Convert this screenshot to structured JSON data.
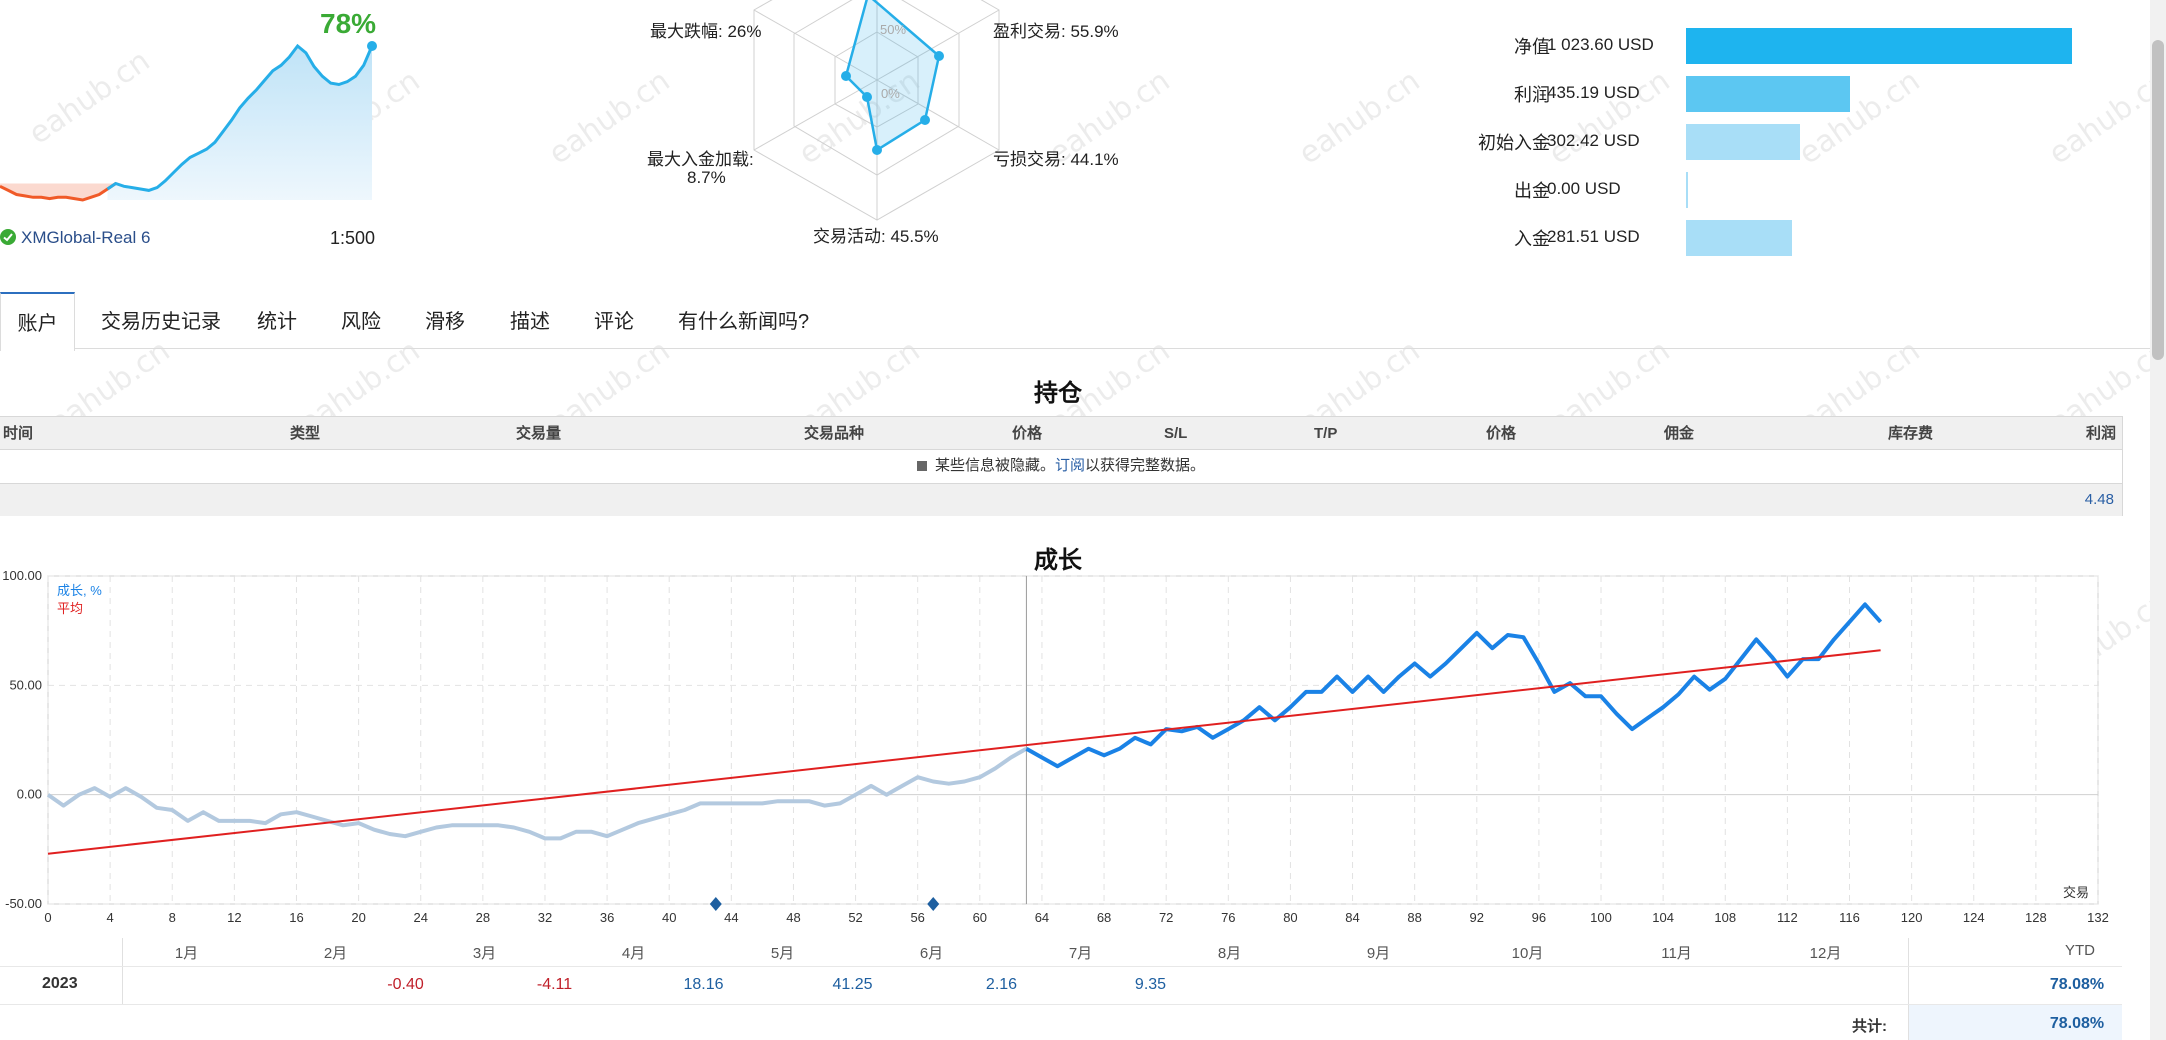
{
  "summary": {
    "growth_pct": "78%",
    "server": "XMGlobal-Real 6",
    "leverage": "1:500"
  },
  "radar": {
    "max_drawdown": "最大跌幅: 26%",
    "profit_trades": "盈利交易: 55.9%",
    "max_deposit_load_l1": "最大入金加载:",
    "max_deposit_load_l2": "8.7%",
    "loss_trades": "亏损交易: 44.1%",
    "activity": "交易活动: 45.5%",
    "ring_50": "50%",
    "ring_0": "0%"
  },
  "balance": {
    "rows": [
      {
        "label": "净值",
        "value": "1 023.60 USD",
        "amount": 1023.6,
        "color": "#1eb4ef"
      },
      {
        "label": "利润",
        "value": "435.19 USD",
        "amount": 435.19,
        "color": "#5cc7f2"
      },
      {
        "label": "初始入金",
        "value": "302.42 USD",
        "amount": 302.42,
        "color": "#a8def7"
      },
      {
        "label": "出金",
        "value": "0.00 USD",
        "amount": 0.0,
        "color": "#a8def7"
      },
      {
        "label": "入金",
        "value": "281.51 USD",
        "amount": 281.51,
        "color": "#a8def7"
      }
    ]
  },
  "tabs": [
    "账户",
    "交易历史记录",
    "统计",
    "风险",
    "滑移",
    "描述",
    "评论",
    "有什么新闻吗?"
  ],
  "positions": {
    "title": "持仓",
    "headers": [
      "时间",
      "类型",
      "交易量",
      "交易品种",
      "价格",
      "S/L",
      "T/P",
      "价格",
      "佣金",
      "库存费",
      "利润"
    ],
    "hidden_text": "某些信息被隐藏。",
    "subscribe_link": "订阅",
    "hidden_text_tail": "以获得完整数据。",
    "total": "4.48"
  },
  "growth": {
    "title": "成长",
    "legend_growth": "成长, %",
    "legend_avg": "平均",
    "x_axis_label": "交易",
    "months": [
      "1月",
      "2月",
      "3月",
      "4月",
      "5月",
      "6月",
      "7月",
      "8月",
      "9月",
      "10月",
      "11月",
      "12月"
    ],
    "year": "2023",
    "month_values": [
      "",
      "-0.40",
      "-4.11",
      "18.16",
      "41.25",
      "2.16",
      "9.35",
      "",
      "",
      "",
      "",
      ""
    ],
    "ytd_label": "YTD",
    "ytd_value": "78.08%",
    "total_label": "共计:",
    "total_value": "78.08%"
  },
  "chart_data": {
    "type": "line",
    "title": "成长",
    "xlabel": "交易",
    "ylabel": "",
    "xlim": [
      0,
      132
    ],
    "ylim": [
      -50,
      100
    ],
    "x_ticks": [
      0,
      4,
      8,
      12,
      16,
      20,
      24,
      28,
      32,
      36,
      40,
      44,
      48,
      52,
      56,
      60,
      64,
      68,
      72,
      76,
      80,
      84,
      88,
      92,
      96,
      100,
      104,
      108,
      112,
      116,
      120,
      124,
      128,
      132
    ],
    "y_ticks": [
      -50,
      0,
      50,
      100
    ],
    "y_tick_labels": [
      "-50.00",
      "0.00",
      "50.00",
      "100.00"
    ],
    "series": [
      {
        "name": "成长, %",
        "color": "#b3c9df",
        "x": [
          0,
          1,
          2,
          3,
          4,
          5,
          6,
          7,
          8,
          9,
          10,
          11,
          12,
          13,
          14,
          15,
          16,
          17,
          18,
          19,
          20,
          21,
          22,
          23,
          24,
          25,
          26,
          27,
          28,
          29,
          30,
          31,
          32,
          33,
          34,
          35,
          36,
          37,
          38,
          39,
          40,
          41,
          42,
          43,
          44,
          45,
          46,
          47,
          48,
          49,
          50,
          51,
          52,
          53,
          54,
          55,
          56,
          57,
          58,
          59,
          60,
          61,
          62,
          63
        ],
        "y": [
          0,
          -5,
          0,
          3,
          -1,
          3,
          -1,
          -6,
          -7,
          -12,
          -8,
          -12,
          -12,
          -12,
          -13,
          -9,
          -8,
          -10,
          -12,
          -14,
          -13,
          -16,
          -18,
          -19,
          -17,
          -15,
          -14,
          -14,
          -14,
          -14,
          -15,
          -17,
          -20,
          -20,
          -17,
          -17,
          -19,
          -16,
          -13,
          -11,
          -9,
          -7,
          -4,
          -4,
          -4,
          -4,
          -4,
          -3,
          -3,
          -3,
          -5,
          -4,
          0,
          4,
          0,
          4,
          8,
          6,
          5,
          6,
          8,
          12,
          17,
          21
        ]
      },
      {
        "name": "成长, %",
        "color": "#1a82e6",
        "x": [
          63,
          64,
          65,
          66,
          67,
          68,
          69,
          70,
          71,
          72,
          73,
          74,
          75,
          76,
          77,
          78,
          79,
          80,
          81,
          82,
          83,
          84,
          85,
          86,
          87,
          88,
          89,
          90,
          91,
          92,
          93,
          94,
          95,
          96,
          97,
          98,
          99,
          100,
          101,
          102,
          103,
          104,
          105,
          106,
          107,
          108,
          109,
          110,
          111,
          112,
          113,
          114,
          115,
          116,
          117,
          118
        ],
        "y": [
          21,
          17,
          13,
          17,
          21,
          18,
          21,
          26,
          23,
          30,
          29,
          31,
          26,
          30,
          34,
          40,
          34,
          40,
          47,
          47,
          54,
          47,
          54,
          47,
          54,
          60,
          54,
          60,
          67,
          74,
          67,
          73,
          72,
          60,
          47,
          51,
          45,
          45,
          37,
          30,
          35,
          40,
          46,
          54,
          48,
          53,
          62,
          71,
          63,
          54,
          62,
          62,
          71,
          79,
          87,
          79
        ]
      },
      {
        "name": "平均",
        "color": "#e02020",
        "x": [
          0,
          118
        ],
        "y": [
          -27,
          66
        ]
      }
    ],
    "markers_x": [
      43,
      57
    ],
    "grid": true,
    "mini_growth_series": [
      -2,
      -5,
      -8,
      -9,
      -10,
      -10,
      -11,
      -10,
      -10,
      -11,
      -12,
      -10,
      -8,
      -4,
      0,
      -2,
      -3,
      -4,
      -5,
      -3,
      2,
      8,
      14,
      19,
      22,
      25,
      30,
      38,
      46,
      55,
      62,
      68,
      75,
      82,
      86,
      92,
      100,
      95,
      85,
      78,
      73,
      72,
      74,
      78,
      86,
      100
    ]
  }
}
